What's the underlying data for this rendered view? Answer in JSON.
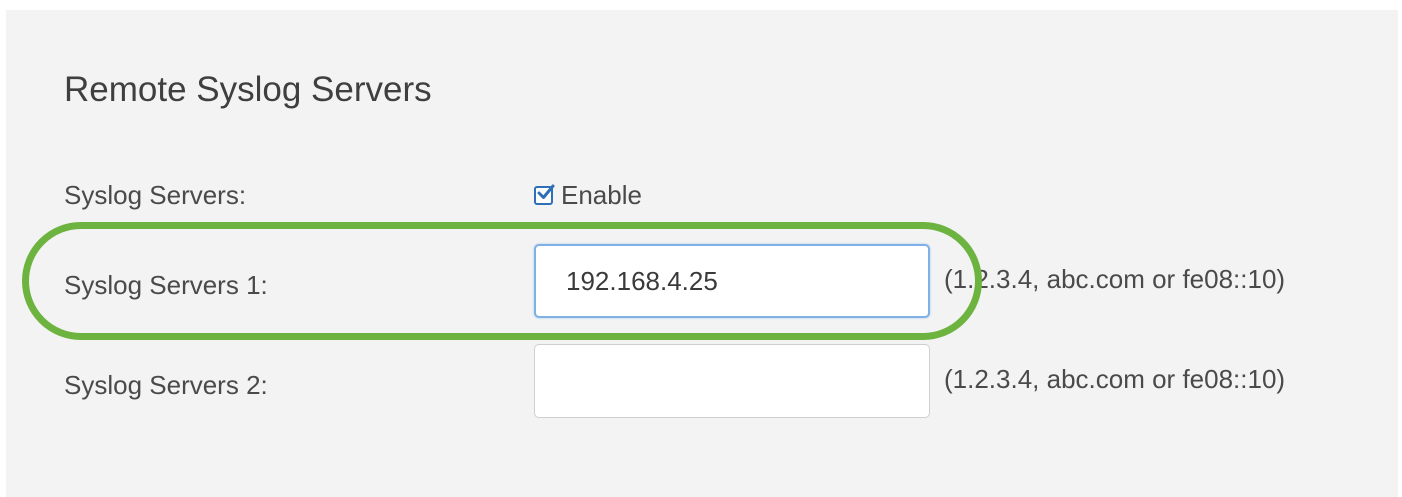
{
  "section": {
    "title": "Remote Syslog Servers"
  },
  "syslog_enable": {
    "label": "Syslog Servers:",
    "checkbox_label": "Enable",
    "checked": true
  },
  "server1": {
    "label": "Syslog Servers 1:",
    "value": "192.168.4.25",
    "hint": "(1.2.3.4, abc.com or fe08::10)"
  },
  "server2": {
    "label": "Syslog Servers 2:",
    "value": "",
    "hint": "(1.2.3.4, abc.com or fe08::10)"
  },
  "colors": {
    "highlight": "#6db33f",
    "checkbox": "#2f6fb5",
    "focus_border": "#7fb0e6"
  },
  "icons": {
    "checkbox": "checkmark-icon"
  }
}
